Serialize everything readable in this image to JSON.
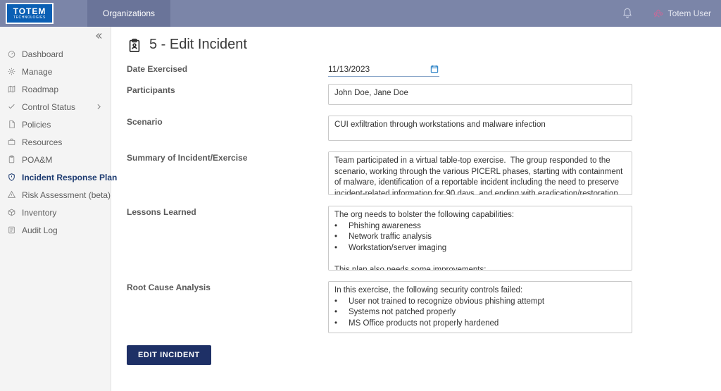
{
  "topbar": {
    "logo_main": "TOTEM",
    "logo_sub": "TECHNOLOGIES",
    "nav_tab": "Organizations",
    "user_name": "Totem User"
  },
  "sidebar": {
    "items": [
      {
        "label": "Dashboard",
        "icon": "gauge-icon"
      },
      {
        "label": "Manage",
        "icon": "cog-icon"
      },
      {
        "label": "Roadmap",
        "icon": "map-icon"
      },
      {
        "label": "Control Status",
        "icon": "check-icon",
        "has_children": true
      },
      {
        "label": "Policies",
        "icon": "doc-icon"
      },
      {
        "label": "Resources",
        "icon": "briefcase-icon"
      },
      {
        "label": "POA&M",
        "icon": "clipboard-icon"
      },
      {
        "label": "Incident Response Plan",
        "icon": "shield-alert-icon",
        "active": true
      },
      {
        "label": "Risk Assessment (beta)",
        "icon": "alert-icon"
      },
      {
        "label": "Inventory",
        "icon": "box-icon"
      },
      {
        "label": "Audit Log",
        "icon": "list-icon"
      }
    ]
  },
  "page": {
    "title": "5 - Edit Incident",
    "submit_label": "EDIT INCIDENT",
    "fields": {
      "date_exercised": {
        "label": "Date Exercised",
        "value": "11/13/2023"
      },
      "participants": {
        "label": "Participants",
        "value": "John Doe, Jane Doe"
      },
      "scenario": {
        "label": "Scenario",
        "value": "CUI exfiltration through workstations and malware infection"
      },
      "summary": {
        "label": "Summary of Incident/Exercise",
        "value": "Team participated in a virtual table-top exercise.  The group responded to the scenario, working through the various PICERL phases, starting with containment of malware, identification of a reportable incident including the need to preserve incident-related information for 90 days, and ending with eradication/restoration."
      },
      "lessons": {
        "label": "Lessons Learned",
        "value": "The org needs to bolster the following capabilities:\n•     Phishing awareness\n•     Network traffic analysis\n•     Workstation/server imaging\n\nThis plan also needs some improvements:\n•     Contact list updated\n•     References to or incorporation of malware infection playbook"
      },
      "root_cause": {
        "label": "Root Cause Analysis",
        "value": "In this exercise, the following security controls failed:\n•     User not trained to recognize obvious phishing attempt\n•     Systems not patched properly\n•     MS Office products not properly hardened\n\nA user with an unpatched and unhardened workstation succumbed to phishing."
      }
    }
  }
}
